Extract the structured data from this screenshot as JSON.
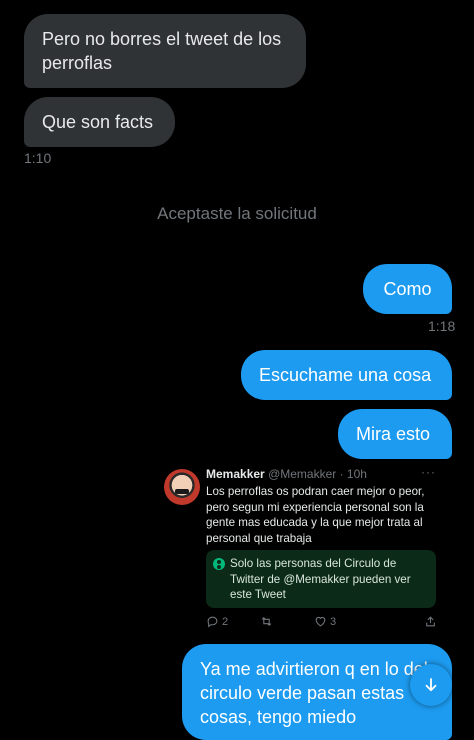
{
  "messages": {
    "in1": "Pero no borres el tweet de los perroflas",
    "in2": "Que son facts",
    "in_time": "1:10",
    "system": "Aceptaste la solicitud",
    "out1": "Como",
    "out1_time": "1:18",
    "out2": "Escuchame una cosa",
    "out3": "Mira esto",
    "out4": "Ya me advirtieron q en lo del circulo verde pasan estas cosas, tengo miedo"
  },
  "tweet": {
    "name": "Memakker",
    "meta": "@Memakker · 10h",
    "more": "···",
    "text": "Los perroflas os podran caer mejor o peor, pero segun mi experiencia personal son la gente mas educada y la que mejor trata al personal que trabaja",
    "circle_notice": "Solo las personas del Circulo de Twitter de @Memakker pueden ver este Tweet",
    "replies": "2",
    "likes": "3"
  },
  "colors": {
    "background": "#000000",
    "incoming_bubble": "#2f3336",
    "outgoing_bubble": "#1d9bf0",
    "circle_green": "#00ba7c"
  },
  "icons": [
    "reply-icon",
    "retweet-icon",
    "like-icon",
    "share-icon",
    "arrow-down-icon"
  ]
}
